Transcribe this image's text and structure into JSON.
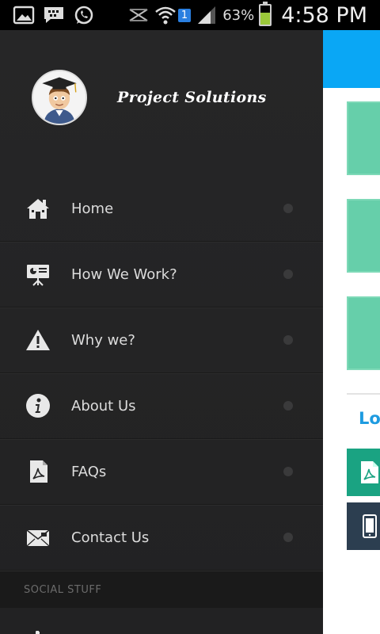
{
  "status_bar": {
    "icons": [
      "gallery-icon",
      "bbm-icon",
      "whatsapp-icon",
      "no-signal-icon",
      "wifi-icon",
      "signal-icon"
    ],
    "sim_badge": "1",
    "battery_percent": "63%",
    "battery_level": 0.63,
    "time": "4:58 PM"
  },
  "drawer": {
    "brand_title": "Project Solutions",
    "menu": [
      {
        "label": "Home",
        "icon": "home-icon"
      },
      {
        "label": "How We Work?",
        "icon": "presentation-icon"
      },
      {
        "label": "Why we?",
        "icon": "warning-icon"
      },
      {
        "label": "About Us",
        "icon": "info-icon"
      },
      {
        "label": "FAQs",
        "icon": "pdf-document-icon"
      },
      {
        "label": "Contact Us",
        "icon": "mail-icon"
      }
    ],
    "section_title": "SOCIAL STUFF"
  },
  "content": {
    "header_color": "#0aa7f5",
    "tile_color": "#66cfaa",
    "peek_text": "Lo",
    "buttons": [
      {
        "icon": "pdf-icon",
        "color": "#1aa382"
      },
      {
        "icon": "mobile-phone-icon",
        "color": "#2c3e50"
      }
    ]
  }
}
